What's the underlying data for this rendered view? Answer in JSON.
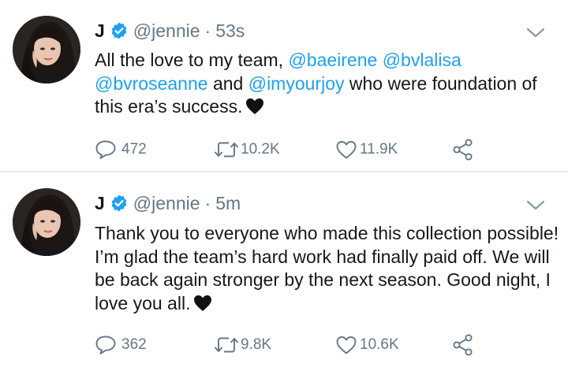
{
  "tweets": [
    {
      "name": "J",
      "handle": "@jennie",
      "separator": "·",
      "time": "53s",
      "text_parts": {
        "p1": "All the love to my team, ",
        "m1": "@baeirene",
        "sp1": " ",
        "m2": "@bvlalisa",
        "m3": "@bvroseanne",
        "p2": " and ",
        "m4": "@imyourjoy",
        "p3": "  who were foundation of this era’s success."
      },
      "replies": "472",
      "retweets": "10.2K",
      "likes": "11.9K"
    },
    {
      "name": "J",
      "handle": "@jennie",
      "separator": "·",
      "time": "5m",
      "text": "Thank you to everyone who made this collection possible! I’m glad the team’s hard work had finally paid off. We will be back again stronger by the next season. Good night, I love you all.",
      "replies": "362",
      "retweets": "9.8K",
      "likes": "10.6K"
    }
  ],
  "colors": {
    "accent": "#1da1f2",
    "muted": "#657786",
    "text": "#14171a",
    "divider": "#e6ecf0"
  },
  "icons": [
    "verified-badge-icon",
    "chevron-down-icon",
    "reply-icon",
    "retweet-icon",
    "like-icon",
    "share-icon",
    "black-heart-emoji"
  ]
}
